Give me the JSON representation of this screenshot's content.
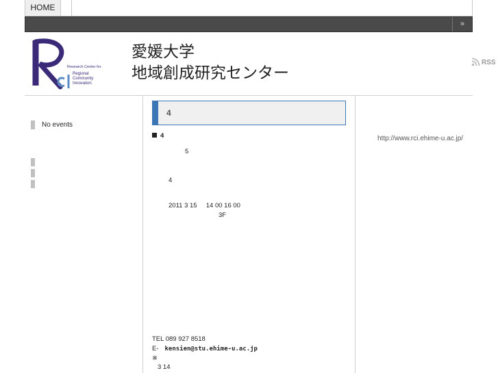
{
  "nav": {
    "home_label": "HOME"
  },
  "header": {
    "title_line1": "愛媛大学",
    "title_line2": "地域創成研究センター",
    "logo_text": [
      "Research Center for",
      "Regional",
      "Community",
      "Innovation"
    ],
    "rss_label": "RSS"
  },
  "sidebar_left": {
    "no_events": "No events"
  },
  "sidebar_right": {
    "url": "http://www.rci.ehime-u.ac.jp/"
  },
  "article": {
    "title": "4",
    "heading": "4",
    "line_5": "5",
    "line_4": "4",
    "date_line": "2011 3 15     14 00 16 00",
    "floor": "3F",
    "tel": "TEL 089 927 8518",
    "email_prefix": "E-",
    "email": "kensien@stu.ehime-u.ac.jp",
    "note_mark": "※",
    "note_date": "3 14"
  },
  "colors": {
    "accent": "#3d76b5",
    "dark_bar": "#4a4a4a",
    "logo_purple": "#3a2a78"
  }
}
